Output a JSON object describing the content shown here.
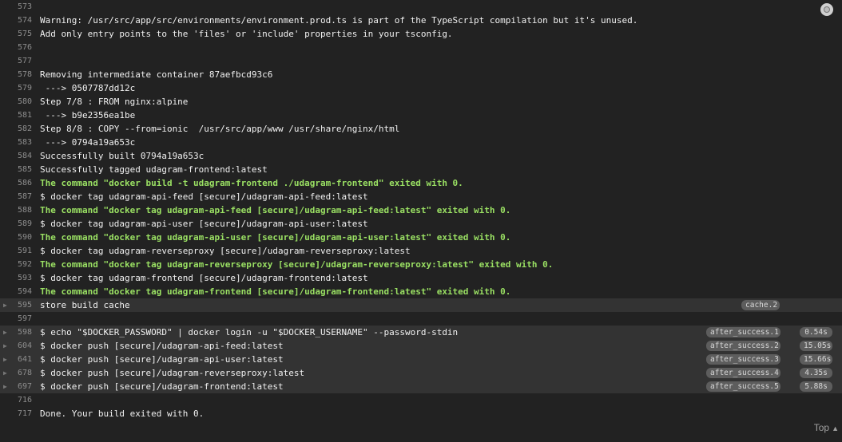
{
  "lines": [
    {
      "num": "573",
      "text": "",
      "style": "white",
      "fold": false,
      "label": "",
      "time": ""
    },
    {
      "num": "574",
      "text": "Warning: /usr/src/app/src/environments/environment.prod.ts is part of the TypeScript compilation but it's unused.",
      "style": "white",
      "fold": false,
      "label": "",
      "time": ""
    },
    {
      "num": "575",
      "text": "Add only entry points to the 'files' or 'include' properties in your tsconfig.",
      "style": "white",
      "fold": false,
      "label": "",
      "time": ""
    },
    {
      "num": "576",
      "text": "",
      "style": "white",
      "fold": false,
      "label": "",
      "time": ""
    },
    {
      "num": "577",
      "text": "",
      "style": "white",
      "fold": false,
      "label": "",
      "time": ""
    },
    {
      "num": "578",
      "text": "Removing intermediate container 87aefbcd93c6",
      "style": "white",
      "fold": false,
      "label": "",
      "time": ""
    },
    {
      "num": "579",
      "text": " ---> 0507787dd12c",
      "style": "white",
      "fold": false,
      "label": "",
      "time": ""
    },
    {
      "num": "580",
      "text": "Step 7/8 : FROM nginx:alpine",
      "style": "white",
      "fold": false,
      "label": "",
      "time": ""
    },
    {
      "num": "581",
      "text": " ---> b9e2356ea1be",
      "style": "white",
      "fold": false,
      "label": "",
      "time": ""
    },
    {
      "num": "582",
      "text": "Step 8/8 : COPY --from=ionic  /usr/src/app/www /usr/share/nginx/html",
      "style": "white",
      "fold": false,
      "label": "",
      "time": ""
    },
    {
      "num": "583",
      "text": " ---> 0794a19a653c",
      "style": "white",
      "fold": false,
      "label": "",
      "time": ""
    },
    {
      "num": "584",
      "text": "Successfully built 0794a19a653c",
      "style": "white",
      "fold": false,
      "label": "",
      "time": ""
    },
    {
      "num": "585",
      "text": "Successfully tagged udagram-frontend:latest",
      "style": "white",
      "fold": false,
      "label": "",
      "time": ""
    },
    {
      "num": "586",
      "text": "The command \"docker build -t udagram-frontend ./udagram-frontend\" exited with 0.",
      "style": "green",
      "fold": false,
      "label": "",
      "time": ""
    },
    {
      "num": "587",
      "text": "$ docker tag udagram-api-feed [secure]/udagram-api-feed:latest",
      "style": "white",
      "fold": false,
      "label": "",
      "time": ""
    },
    {
      "num": "588",
      "text": "The command \"docker tag udagram-api-feed [secure]/udagram-api-feed:latest\" exited with 0.",
      "style": "green",
      "fold": false,
      "label": "",
      "time": ""
    },
    {
      "num": "589",
      "text": "$ docker tag udagram-api-user [secure]/udagram-api-user:latest",
      "style": "white",
      "fold": false,
      "label": "",
      "time": ""
    },
    {
      "num": "590",
      "text": "The command \"docker tag udagram-api-user [secure]/udagram-api-user:latest\" exited with 0.",
      "style": "green",
      "fold": false,
      "label": "",
      "time": ""
    },
    {
      "num": "591",
      "text": "$ docker tag udagram-reverseproxy [secure]/udagram-reverseproxy:latest",
      "style": "white",
      "fold": false,
      "label": "",
      "time": ""
    },
    {
      "num": "592",
      "text": "The command \"docker tag udagram-reverseproxy [secure]/udagram-reverseproxy:latest\" exited with 0.",
      "style": "green",
      "fold": false,
      "label": "",
      "time": ""
    },
    {
      "num": "593",
      "text": "$ docker tag udagram-frontend [secure]/udagram-frontend:latest",
      "style": "white",
      "fold": false,
      "label": "",
      "time": ""
    },
    {
      "num": "594",
      "text": "The command \"docker tag udagram-frontend [secure]/udagram-frontend:latest\" exited with 0.",
      "style": "green",
      "fold": false,
      "label": "",
      "time": ""
    },
    {
      "num": "595",
      "text": "store build cache",
      "style": "white",
      "fold": true,
      "label": "cache.2",
      "time": ""
    },
    {
      "num": "597",
      "text": "",
      "style": "white",
      "fold": false,
      "label": "",
      "time": ""
    },
    {
      "num": "598",
      "text": "$ echo \"$DOCKER_PASSWORD\" | docker login -u \"$DOCKER_USERNAME\" --password-stdin",
      "style": "white",
      "fold": true,
      "label": "after_success.1",
      "time": "0.54s"
    },
    {
      "num": "604",
      "text": "$ docker push [secure]/udagram-api-feed:latest",
      "style": "white",
      "fold": true,
      "label": "after_success.2",
      "time": "15.05s"
    },
    {
      "num": "641",
      "text": "$ docker push [secure]/udagram-api-user:latest",
      "style": "white",
      "fold": true,
      "label": "after_success.3",
      "time": "15.66s"
    },
    {
      "num": "678",
      "text": "$ docker push [secure]/udagram-reverseproxy:latest",
      "style": "white",
      "fold": true,
      "label": "after_success.4",
      "time": "4.35s"
    },
    {
      "num": "697",
      "text": "$ docker push [secure]/udagram-frontend:latest",
      "style": "white",
      "fold": true,
      "label": "after_success.5",
      "time": "5.88s"
    },
    {
      "num": "716",
      "text": "",
      "style": "white",
      "fold": false,
      "label": "",
      "time": ""
    },
    {
      "num": "717",
      "text": "Done. Your build exited with 0.",
      "style": "white",
      "fold": false,
      "label": "",
      "time": ""
    }
  ],
  "footer": {
    "top_label": "Top",
    "top_icon": "caret-up-icon"
  },
  "toolbar": {
    "status_icon": "circle-icon"
  }
}
